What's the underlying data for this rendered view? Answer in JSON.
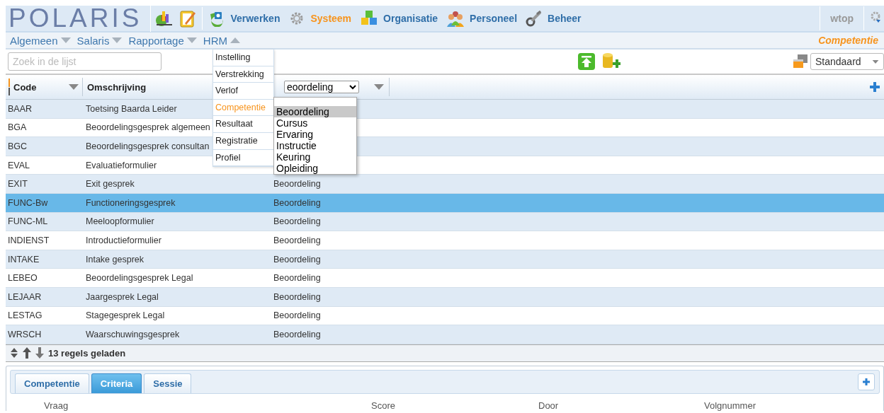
{
  "app": {
    "logo": "POLARIS",
    "user": "wtop"
  },
  "nav": [
    {
      "label": "Verwerken",
      "selected": false
    },
    {
      "label": "Systeem",
      "selected": true
    },
    {
      "label": "Organisatie",
      "selected": false
    },
    {
      "label": "Personeel",
      "selected": false
    },
    {
      "label": "Beheer",
      "selected": false
    }
  ],
  "subnav": [
    {
      "label": "Algemeen",
      "expanded": false
    },
    {
      "label": "Salaris",
      "expanded": false
    },
    {
      "label": "Rapportage",
      "expanded": false
    },
    {
      "label": "HRM",
      "expanded": true
    }
  ],
  "breadcrumb": "Competentie",
  "hrm_menu": [
    {
      "label": "Instelling",
      "selected": false
    },
    {
      "label": "Verstrekking",
      "selected": false
    },
    {
      "label": "Verlof",
      "selected": false
    },
    {
      "label": "Competentie",
      "selected": true
    },
    {
      "label": "Resultaat",
      "selected": false
    },
    {
      "label": "Registratie",
      "selected": false
    },
    {
      "label": "Profiel",
      "selected": false
    }
  ],
  "search": {
    "placeholder": "Zoek in de lijst"
  },
  "view_select": {
    "value": "Standaard"
  },
  "table": {
    "columns": [
      "Code",
      "Omschrijving"
    ],
    "type_filter": {
      "value": "eoordeling",
      "options": [
        {
          "label": "Beoordeling",
          "selected": true
        },
        {
          "label": "Cursus",
          "selected": false
        },
        {
          "label": "Ervaring",
          "selected": false
        },
        {
          "label": "Instructie",
          "selected": false
        },
        {
          "label": "Keuring",
          "selected": false
        },
        {
          "label": "Opleiding",
          "selected": false
        }
      ]
    },
    "rows": [
      {
        "code": "BAAR",
        "description": "Toetsing Baarda Leider",
        "selected": false
      },
      {
        "code": "BGA",
        "description": "Beoordelingsgesprek algemeen",
        "selected": false
      },
      {
        "code": "BGC",
        "description": "Beoordelingsgesprek consultan",
        "selected": false
      },
      {
        "code": "EVAL",
        "description": "Evaluatieformulier",
        "selected": false
      },
      {
        "code": "EXIT",
        "description": "Exit gesprek",
        "type": "Beoordeling",
        "selected": false
      },
      {
        "code": "FUNC-Bw",
        "description": "Functioneringsgesprek",
        "type": "Beoordeling",
        "selected": true
      },
      {
        "code": "FUNC-ML",
        "description": "Meeloopformulier",
        "type": "Beoordeling",
        "selected": false
      },
      {
        "code": "INDIENST",
        "description": "Introductieformulier",
        "type": "Beoordeling",
        "selected": false
      },
      {
        "code": "INTAKE",
        "description": "Intake gesprek",
        "type": "Beoordeling",
        "selected": false
      },
      {
        "code": "LEBEO",
        "description": "Beoordelingsgesprek Legal",
        "type": "Beoordeling",
        "selected": false
      },
      {
        "code": "LEJAAR",
        "description": "Jaargesprek Legal",
        "type": "Beoordeling",
        "selected": false
      },
      {
        "code": "LESTAG",
        "description": "Stagegesprek Legal",
        "type": "Beoordeling",
        "selected": false
      },
      {
        "code": "WRSCH",
        "description": "Waarschuwingsgesprek",
        "type": "Beoordeling",
        "selected": false
      }
    ],
    "status": "13 regels geladen"
  },
  "detail": {
    "tabs": [
      {
        "label": "Competentie",
        "selected": false
      },
      {
        "label": "Criteria",
        "selected": true
      },
      {
        "label": "Sessie",
        "selected": false
      }
    ],
    "columns": [
      "Vraag",
      "Score",
      "Door",
      "Volgnummer"
    ]
  }
}
